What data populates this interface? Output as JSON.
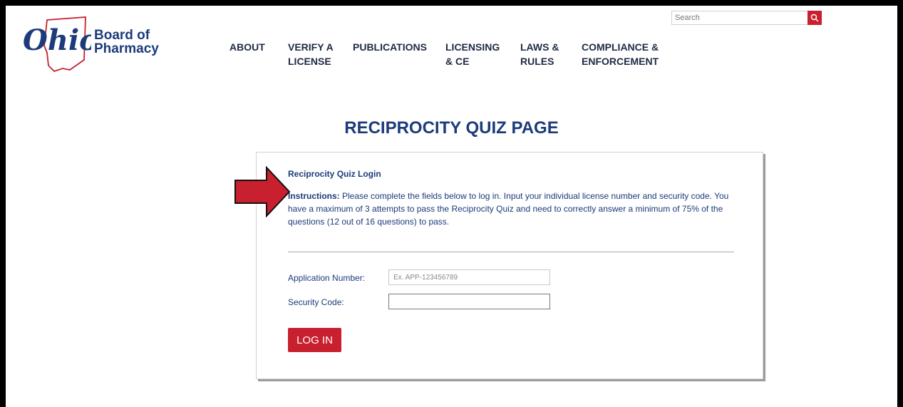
{
  "logo": {
    "line1": "Board of",
    "line2": "Pharmacy",
    "script_text": "Ohio"
  },
  "nav": [
    {
      "label": "ABOUT"
    },
    {
      "label": "VERIFY A LICENSE"
    },
    {
      "label": "PUBLICATIONS"
    },
    {
      "label": "LICENSING & CE"
    },
    {
      "label": "LAWS & RULES"
    },
    {
      "label": "COMPLIANCE & ENFORCEMENT"
    }
  ],
  "search": {
    "placeholder": "Search",
    "icon": "search-icon"
  },
  "page_title": "RECIPROCITY QUIZ PAGE",
  "card": {
    "heading": "Reciprocity Quiz Login",
    "instructions_label": "Instructions:",
    "instructions_text": " Please complete the fields below to log in. Input your individual license number and security code.  You have a maximum of 3 attempts to pass the Reciprocity Quiz and need to correctly answer a minimum of 75% of the questions (12 out of 16 questions) to pass.",
    "fields": {
      "application_label": "Application Number:",
      "application_placeholder": "Ex. APP-123456789",
      "application_value": "",
      "security_label": "Security Code:",
      "security_value": ""
    },
    "login_label": "LOG IN"
  },
  "colors": {
    "brand_blue": "#1b3b7a",
    "brand_red": "#c8202f"
  }
}
